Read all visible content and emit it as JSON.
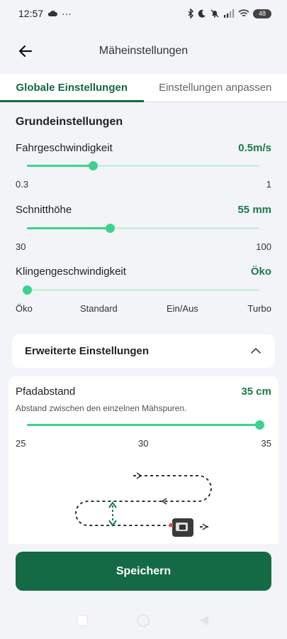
{
  "status_bar": {
    "time": "12:57",
    "dots": "···",
    "battery": "48"
  },
  "app_bar": {
    "title": "Mäheinstellungen"
  },
  "tabs": [
    {
      "label": "Globale Einstellungen",
      "active": true
    },
    {
      "label": "Einstellungen anpassen",
      "active": false
    }
  ],
  "basic": {
    "title": "Grundeinstellungen",
    "speed": {
      "label": "Fahrgeschwindigkeit",
      "value": "0.5m/s",
      "min_label": "0.3",
      "max_label": "1",
      "fraction": 0.286
    },
    "height": {
      "label": "Schnitthöhe",
      "value": "55 mm",
      "min_label": "30",
      "max_label": "100",
      "fraction": 0.357
    },
    "blade": {
      "label": "Klingengeschwindigkeit",
      "value": "Öko",
      "options": [
        "Öko",
        "Standard",
        "Ein/Aus",
        "Turbo"
      ],
      "fraction": 0.0
    }
  },
  "advanced": {
    "title": "Erweiterte Einstellungen"
  },
  "path": {
    "label": "Pfadabstand",
    "value": "35 cm",
    "description": "Abstand zwischen den einzelnen Mähspuren.",
    "ticks": [
      "25",
      "30",
      "35"
    ],
    "fraction": 1.0
  },
  "save_label": "Speichern",
  "colors": {
    "brand": "#146A44",
    "accent": "#3DD28F",
    "track": "#CDEEDD",
    "value": "#1A7A4C"
  }
}
